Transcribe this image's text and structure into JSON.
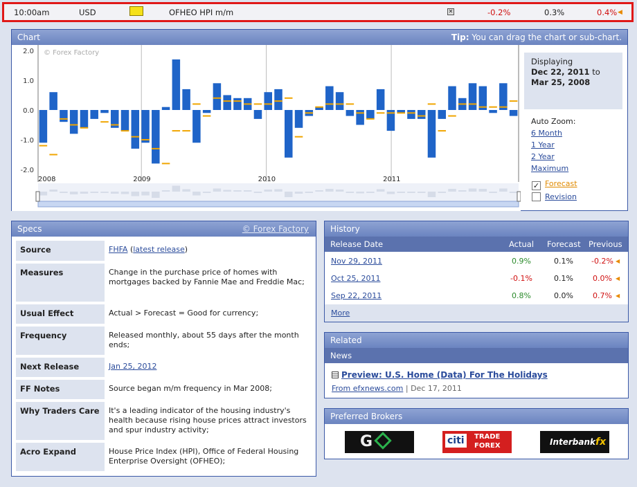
{
  "topbar": {
    "time": "10:00am",
    "currency": "USD",
    "event": "OFHEO HPI m/m",
    "actual": "-0.2%",
    "forecast": "0.3%",
    "previous": "0.4%"
  },
  "chart": {
    "title": "Chart",
    "tip_bold": "Tip:",
    "tip_text": " You can drag the chart or sub-chart.",
    "watermark": "© Forex Factory",
    "displaying": "Displaying",
    "from": "Dec 22, 2011",
    "to_word": "to",
    "to": "Mar 25, 2008",
    "auto_zoom": "Auto Zoom:",
    "zoom_options": [
      "6 Month",
      "1 Year",
      "2 Year",
      "Maximum"
    ],
    "forecast_label": "Forecast",
    "revision_label": "Revision"
  },
  "chart_data": {
    "type": "bar",
    "yticks": [
      "2.0",
      "1.0",
      "0.0",
      "-1.0",
      "-2.0"
    ],
    "ylim": [
      -2.0,
      2.0
    ],
    "xtick_labels": [
      "2008",
      "2009",
      "2010",
      "2011"
    ],
    "values": [
      -1.1,
      0.6,
      -0.4,
      -0.8,
      -0.6,
      -0.3,
      -0.1,
      -0.6,
      -0.7,
      -1.3,
      -1.1,
      -1.8,
      0.1,
      1.7,
      0.7,
      -1.1,
      -0.1,
      0.9,
      0.5,
      0.4,
      0.4,
      -0.3,
      0.6,
      0.7,
      -1.6,
      -0.6,
      -0.2,
      0.1,
      0.8,
      0.6,
      -0.2,
      -0.5,
      -0.3,
      0.7,
      -0.7,
      -0.1,
      -0.3,
      -0.3,
      -1.6,
      -0.3,
      0.8,
      0.4,
      0.9,
      0.8,
      -0.1,
      0.9,
      -0.2
    ],
    "forecast": [
      -1.2,
      -1.5,
      -0.3,
      -0.5,
      -0.6,
      null,
      -0.4,
      -0.5,
      -0.7,
      -0.9,
      -1.0,
      -1.3,
      -1.8,
      -0.7,
      -0.7,
      0.2,
      -0.2,
      0.4,
      0.3,
      0.3,
      0.2,
      0.2,
      0.2,
      0.3,
      0.4,
      -0.9,
      -0.1,
      0.1,
      0.2,
      0.2,
      0.2,
      -0.1,
      -0.3,
      -0.1,
      -0.1,
      -0.1,
      -0.1,
      -0.2,
      0.2,
      -0.7,
      -0.2,
      0.2,
      0.2,
      0.1,
      0.1,
      0.1,
      0.3
    ]
  },
  "specs": {
    "title": "Specs",
    "credit": "© Forex Factory",
    "rows": [
      {
        "label": "Source",
        "value": ""
      },
      {
        "label": "Measures",
        "value": "Change in the purchase price of homes with mortgages backed by Fannie Mae and Freddie Mac;"
      },
      {
        "label": "Usual Effect",
        "value": "Actual > Forecast = Good for currency;"
      },
      {
        "label": "Frequency",
        "value": "Released monthly, about 55 days after the month ends;"
      },
      {
        "label": "Next Release",
        "value": "Jan 25, 2012"
      },
      {
        "label": "FF Notes",
        "value": "Source began m/m frequency in Mar 2008;"
      },
      {
        "label": "Why Traders Care",
        "value": "It's a leading indicator of the housing industry's health because rising house prices attract investors and spur industry activity;"
      },
      {
        "label": "Acro Expand",
        "value": "House Price Index (HPI), Office of Federal Housing Enterprise Oversight (OFHEO);"
      }
    ],
    "source_link": "FHFA",
    "source_paren_open": "(",
    "source_release": "latest release",
    "source_paren_close": ")"
  },
  "history": {
    "title": "History",
    "col_date": "Release Date",
    "col_actual": "Actual",
    "col_forecast": "Forecast",
    "col_previous": "Previous",
    "rows": [
      {
        "date": "Nov 29, 2011",
        "actual": "0.9%",
        "forecast": "0.1%",
        "previous": "-0.2%"
      },
      {
        "date": "Oct 25, 2011",
        "actual": "-0.1%",
        "forecast": "0.1%",
        "previous": "0.0%"
      },
      {
        "date": "Sep 22, 2011",
        "actual": "0.8%",
        "forecast": "0.0%",
        "previous": "0.7%"
      }
    ],
    "more": "More"
  },
  "related": {
    "title": "Related",
    "news_label": "News",
    "headline": "Preview: U.S. Home (Data) For The Holidays",
    "source": "From efxnews.com",
    "sep": "|",
    "date": "Dec 17, 2011"
  },
  "brokers": {
    "title": "Preferred Brokers",
    "go_text": "G",
    "citi_text": "citi",
    "citi_trade": "TRADE",
    "citi_forex": "FOREX",
    "ib_text": "Interbank",
    "ib_fx": "fx"
  }
}
